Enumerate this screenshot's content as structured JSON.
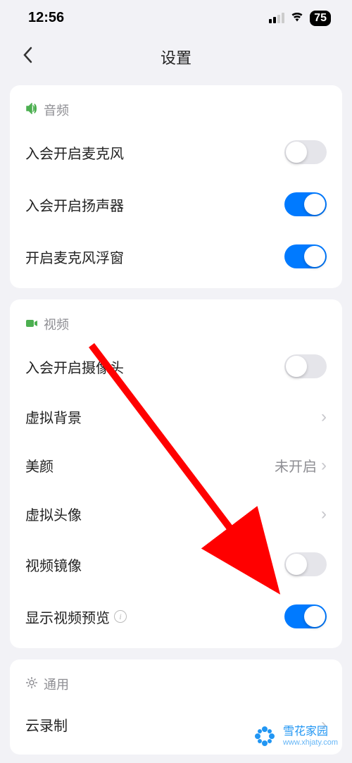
{
  "status_bar": {
    "time": "12:56",
    "battery": "75"
  },
  "header": {
    "title": "设置"
  },
  "sections": {
    "audio": {
      "title": "音频",
      "items": {
        "mic_on_join": {
          "label": "入会开启麦克风",
          "on": false
        },
        "speaker_on_join": {
          "label": "入会开启扬声器",
          "on": true
        },
        "mic_float": {
          "label": "开启麦克风浮窗",
          "on": true
        }
      }
    },
    "video": {
      "title": "视频",
      "items": {
        "camera_on_join": {
          "label": "入会开启摄像头",
          "on": false
        },
        "virtual_bg": {
          "label": "虚拟背景"
        },
        "beauty": {
          "label": "美颜",
          "value": "未开启"
        },
        "virtual_avatar": {
          "label": "虚拟头像"
        },
        "video_mirror": {
          "label": "视频镜像",
          "on": false
        },
        "show_preview": {
          "label": "显示视频预览",
          "on": true
        }
      }
    },
    "general": {
      "title": "通用",
      "items": {
        "cloud_record": {
          "label": "云录制"
        }
      }
    }
  },
  "watermark": {
    "name": "雪花家园",
    "url": "www.xhjaty.com"
  }
}
